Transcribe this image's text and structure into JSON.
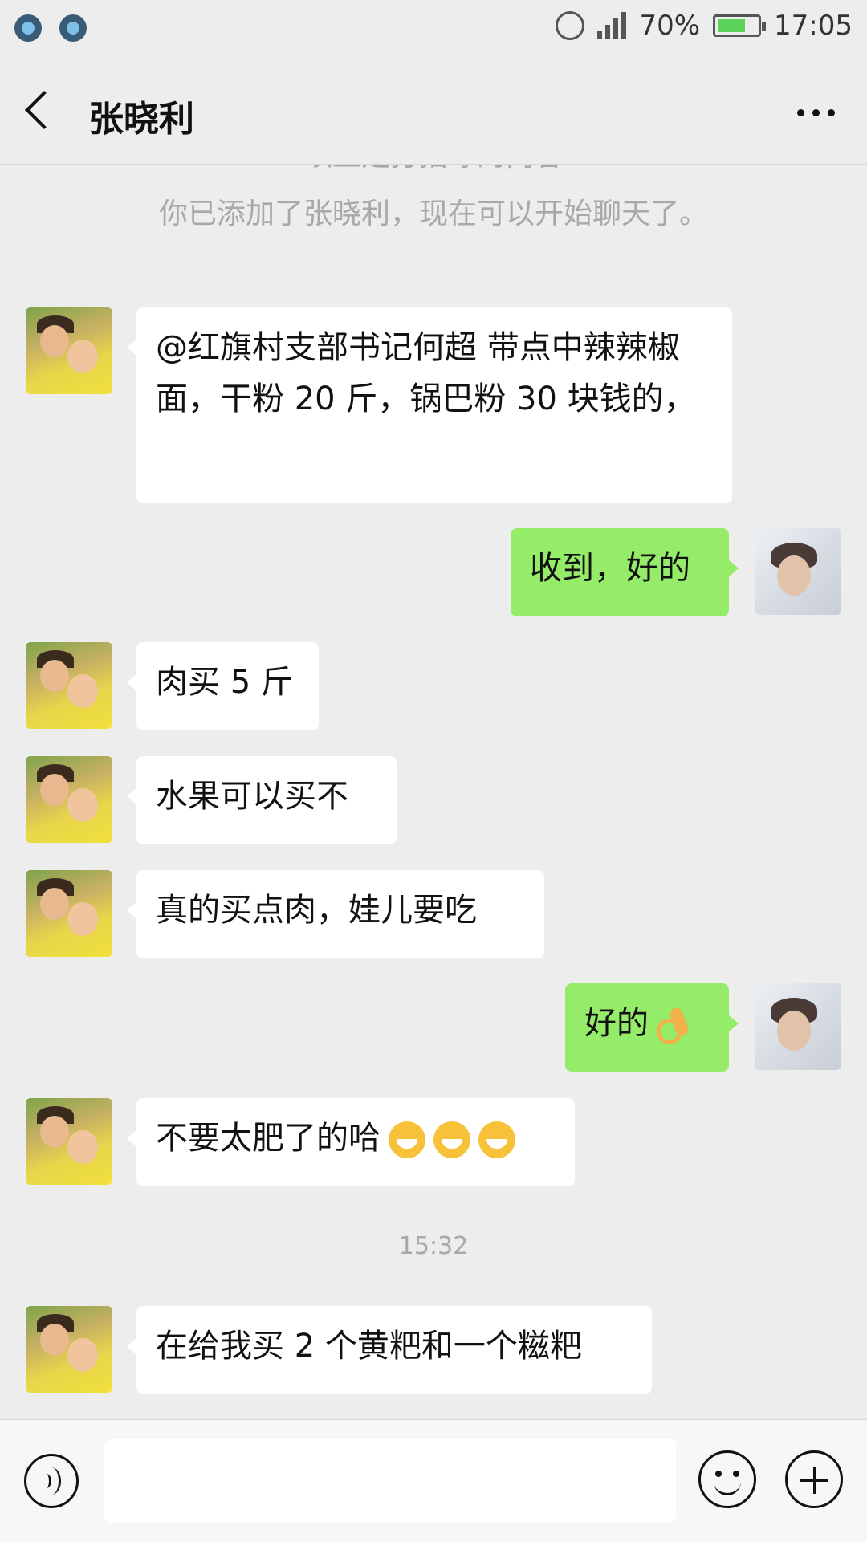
{
  "status_bar": {
    "battery": "70%",
    "battery_level": 0.7,
    "time": "17:05"
  },
  "header": {
    "title": "张晓利"
  },
  "system_messages": {
    "greeting_note": "以上是打招呼的内容",
    "added_note": "你已添加了张晓利，现在可以开始聊天了。",
    "timestamp": "15:32"
  },
  "messages": [
    {
      "side": "left",
      "text": "@红旗村支部书记何超  带点中辣辣椒面，干粉 20 斤，锅巴粉 30 块钱的，"
    },
    {
      "side": "right",
      "text": "收到，好的"
    },
    {
      "side": "left",
      "text": "肉买 5 斤"
    },
    {
      "side": "left",
      "text": "水果可以买不"
    },
    {
      "side": "left",
      "text": "真的买点肉，娃儿要吃"
    },
    {
      "side": "right",
      "text": "好的",
      "emoji": "ok-hand-emoji"
    },
    {
      "side": "left",
      "text": "不要太肥了的哈",
      "emoji": "grin-emoji x3"
    },
    {
      "side": "left",
      "text": "在给我买 2 个黄粑和一个糍粑"
    }
  ],
  "input_bar": {
    "value": "",
    "icons": [
      "voice-icon",
      "emoji-icon",
      "plus-icon"
    ]
  },
  "colors": {
    "background": "#ededed",
    "self_bubble": "#95ec69",
    "other_bubble": "#ffffff"
  }
}
